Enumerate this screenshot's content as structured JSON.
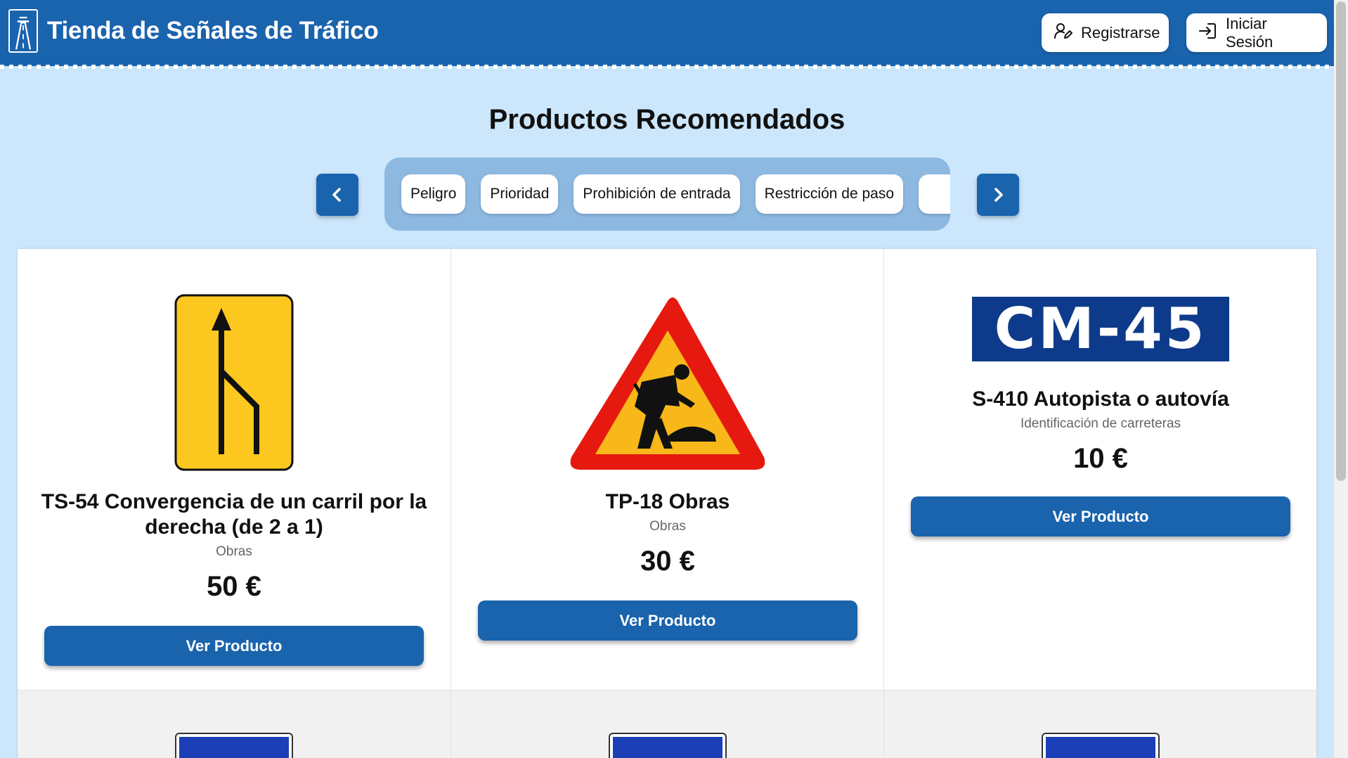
{
  "header": {
    "title": "Tienda de Señales de Tráfico",
    "register_label": "Registrarse",
    "login_label": "Iniciar Sesión",
    "bg_color": "#1a63ad"
  },
  "section": {
    "title": "Productos Recomendados"
  },
  "categories": [
    "Peligro",
    "Prioridad",
    "Prohibición de entrada",
    "Restricción de paso"
  ],
  "products": [
    {
      "name": "TS-54 Convergencia de un carril por la derecha (de 2 a 1)",
      "category": "Obras",
      "price": "50 €",
      "button": "Ver Producto",
      "icon": "lane-merge-sign-icon"
    },
    {
      "name": "TP-18 Obras",
      "category": "Obras",
      "price": "30 €",
      "button": "Ver Producto",
      "icon": "roadworks-triangle-icon"
    },
    {
      "name": "S-410 Autopista o autovía",
      "category": "Identificación de carreteras",
      "price": "10 €",
      "button": "Ver Producto",
      "sign_text": "CM-45",
      "icon": "road-id-plate-icon"
    }
  ],
  "colors": {
    "page_bg": "#cce6fc",
    "primary": "#1a63ad",
    "card_bg": "#ffffff"
  }
}
